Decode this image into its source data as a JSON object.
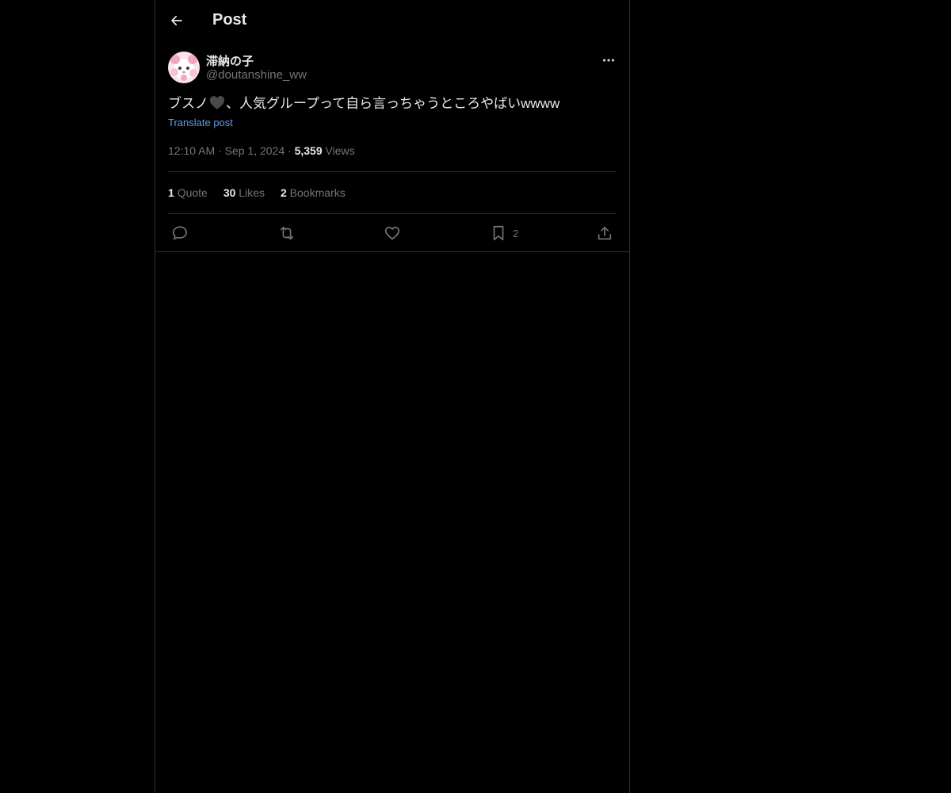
{
  "header": {
    "title": "Post",
    "back_icon": "arrow-left-icon"
  },
  "author": {
    "display_name": "滞納の子",
    "handle": "@doutanshine_ww",
    "avatar_icon": "avatar-image"
  },
  "post": {
    "text_before_emoji": "ブスノ",
    "emoji": "black-heart-icon",
    "text_after_emoji": "、人気グループって自ら言っちゃうところやばいwwww",
    "translate_label": "Translate post",
    "time": "12:10 AM",
    "separator": "·",
    "date": "Sep 1, 2024",
    "views_count": "5,359",
    "views_label": "Views"
  },
  "stats": [
    {
      "count": "1",
      "label": "Quote"
    },
    {
      "count": "30",
      "label": "Likes"
    },
    {
      "count": "2",
      "label": "Bookmarks"
    }
  ],
  "actions": {
    "reply_icon": "reply-icon",
    "repost_icon": "repost-icon",
    "like_icon": "heart-icon",
    "bookmark_icon": "bookmark-icon",
    "bookmark_count": "2",
    "share_icon": "share-icon"
  },
  "colors": {
    "background": "#000000",
    "text": "#e7e9ea",
    "secondary": "#71767b",
    "link": "#5b9df0",
    "border": "#2f3336"
  }
}
